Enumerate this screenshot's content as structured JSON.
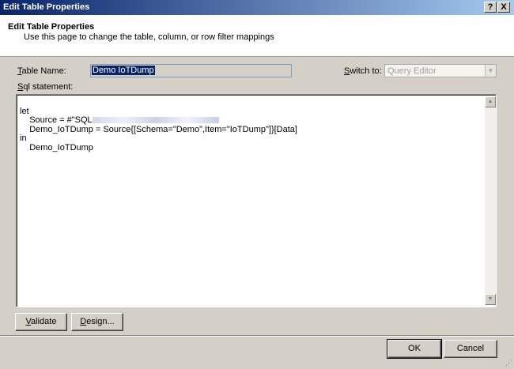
{
  "window": {
    "title": "Edit Table Properties",
    "help_label": "?",
    "close_label": "X"
  },
  "header": {
    "title": "Edit Table Properties",
    "subtitle": "Use this page to change the table, column, or row filter mappings"
  },
  "table_name": {
    "label_mnemonic": "T",
    "label_rest": "able Name:",
    "value": "Demo IoTDump"
  },
  "switch_to": {
    "label_pre": "",
    "label_mnemonic": "S",
    "label_rest": "witch to:",
    "value": "Query Editor"
  },
  "sql": {
    "label_mnemonic": "S",
    "label_rest": "ql statement:",
    "lines": [
      "let",
      "    Source = #\"SQL",
      "    Demo_IoTDump = Source{[Schema=\"Demo\",Item=\"IoTDump\"]}[Data]",
      "in",
      "    Demo_IoTDump"
    ]
  },
  "buttons": {
    "validate_mnemonic": "V",
    "validate_rest": "alidate",
    "design_mnemonic": "D",
    "design_rest": "esign...",
    "ok": "OK",
    "cancel": "Cancel"
  }
}
